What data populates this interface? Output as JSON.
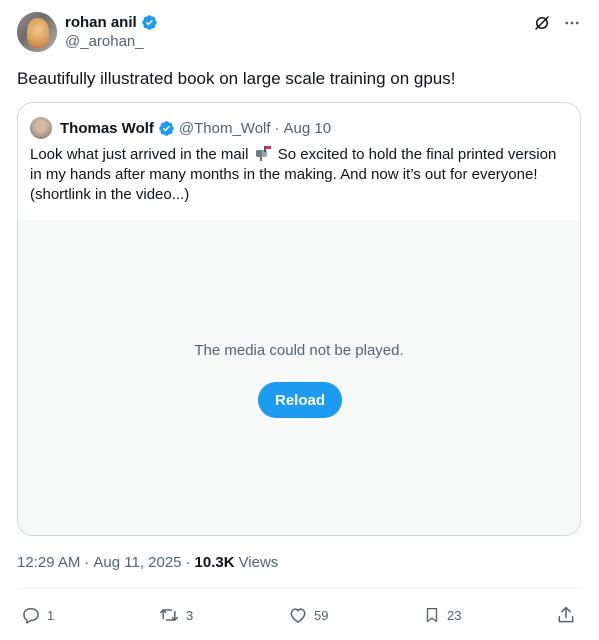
{
  "author": {
    "name": "rohan anil",
    "handle": "@_arohan_"
  },
  "tweet": {
    "text": "Beautifully illustrated book on large scale training on gpus!"
  },
  "quote": {
    "name": "Thomas Wolf",
    "handle": "@Thom_Wolf",
    "separator": "·",
    "date": "Aug 10",
    "text_before_emoji": "Look what just arrived in the mail",
    "text_after_emoji": "So excited to hold the final printed version in my hands after many months in the making. And now it’s out for everyone! (shortlink in the video...)",
    "emoji": "mailbox-icon",
    "media": {
      "message": "The media could not be played.",
      "reload_label": "Reload"
    }
  },
  "meta": {
    "time": "12:29 AM",
    "separator": "·",
    "date": "Aug 11, 2025",
    "separator2": "·",
    "views_count": "10.3K",
    "views_label": "Views"
  },
  "actions": {
    "replies": "1",
    "reposts": "3",
    "likes": "59",
    "bookmarks": "23"
  },
  "colors": {
    "accent": "#1d9bf0",
    "text": "#0f1419",
    "secondary": "#536471",
    "border": "#cfd9de",
    "media_bg": "#f7f9f9"
  },
  "icons": [
    "verified-badge-icon",
    "grok-icon",
    "more-icon",
    "reply-icon",
    "repost-icon",
    "like-icon",
    "bookmark-icon",
    "share-icon",
    "mailbox-icon"
  ]
}
